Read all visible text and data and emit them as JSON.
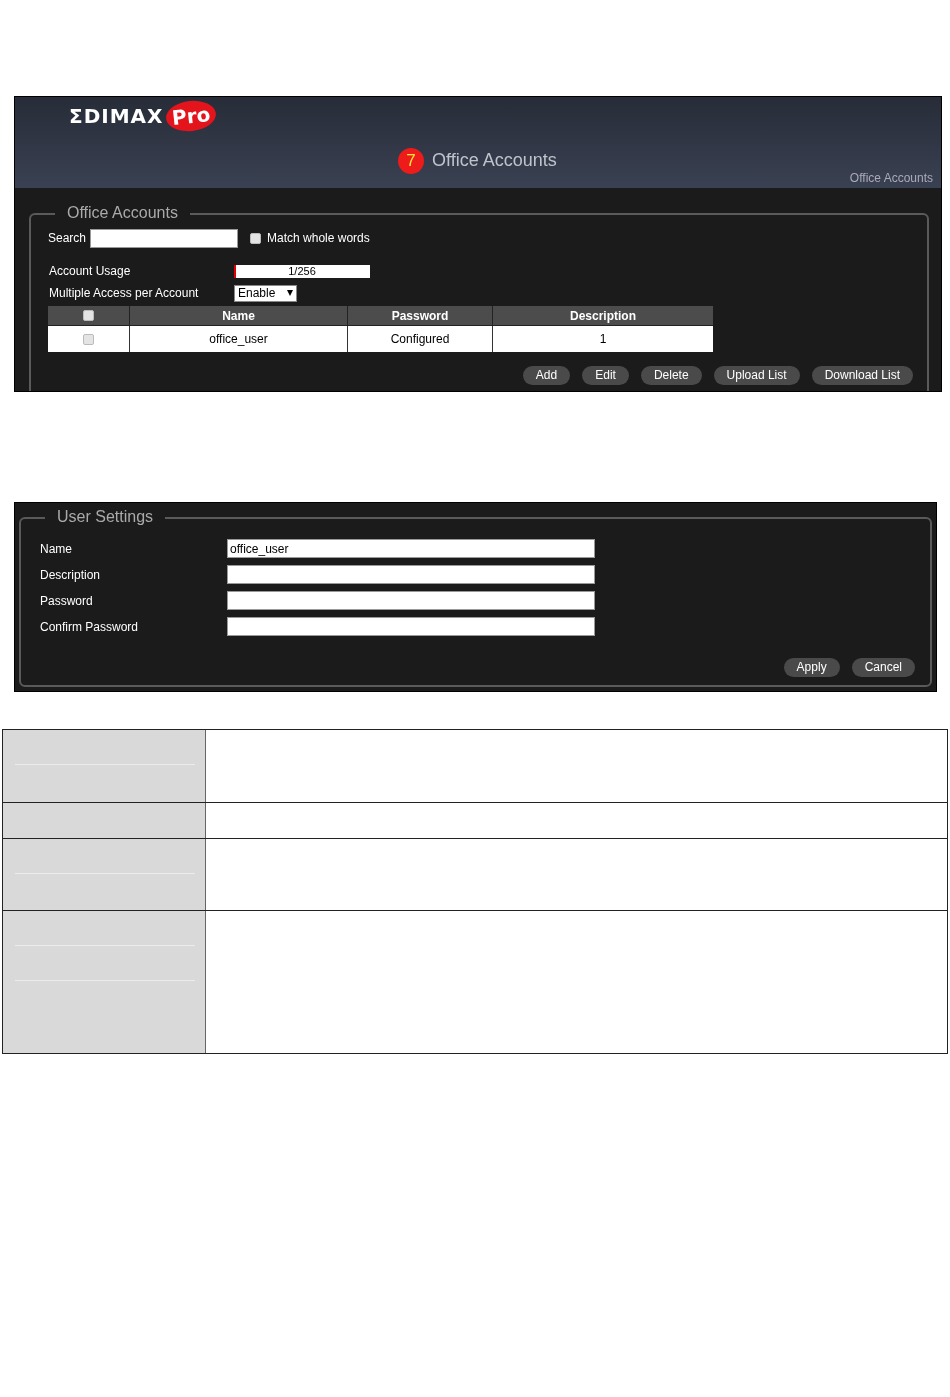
{
  "accounts_screen": {
    "logo": {
      "word": "ΣDIMAX",
      "badge": "Pro"
    },
    "step_badge": "7",
    "title": "Office Accounts",
    "breadcrumb": "Office Accounts",
    "panel_title": "Office Accounts",
    "search": {
      "label": "Search"
    },
    "match_whole_words": {
      "label": "Match whole words",
      "checked": false
    },
    "account_usage": {
      "label": "Account Usage",
      "level": 0.004,
      "reading": "1/256"
    },
    "multiple_access": {
      "label": "Multiple Access per Account",
      "value": "Enable"
    },
    "table": {
      "select_all_checked": false,
      "columns": [
        "Name",
        "Password",
        "Description"
      ],
      "rows": [
        {
          "checked": false,
          "cells": [
            "office_user",
            "Configured",
            "1"
          ]
        }
      ]
    },
    "buttons": [
      "Add",
      "Edit",
      "Delete",
      "Upload List",
      "Download List"
    ]
  },
  "user_settings_screen": {
    "panel_title": "User Settings",
    "fields": [
      {
        "label": "Name",
        "value": "office_user"
      },
      {
        "label": "Description"
      },
      {
        "label": "Password"
      },
      {
        "label": "Confirm Password"
      }
    ],
    "buttons": [
      "Apply",
      "Cancel"
    ]
  },
  "description_table": {
    "rows": [
      {
        "kind": "tall"
      },
      {
        "kind": "short"
      },
      {
        "kind": "tall"
      },
      {
        "kind": "extra_tall"
      }
    ]
  }
}
